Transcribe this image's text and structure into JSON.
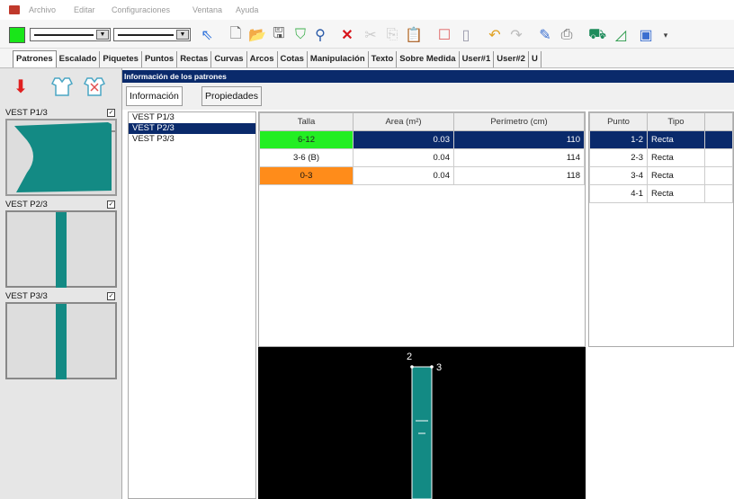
{
  "menu": {
    "items": [
      "Archivo",
      "Editar",
      "Configuraciones",
      "Ventana",
      "Ayuda"
    ]
  },
  "toolbar": {
    "color_swatch": "#19e619",
    "icons": [
      "pointer-icon",
      "new-icon",
      "open-icon",
      "save-icon",
      "garment-icon",
      "find-icon",
      "delete-icon",
      "cut-icon",
      "copy-icon",
      "paste-icon",
      "frame-icon",
      "page-icon",
      "undo-icon",
      "redo-icon",
      "edit-icon",
      "print-icon",
      "pattern-icon",
      "ruler-icon",
      "export-icon"
    ]
  },
  "tabs": [
    "Patrones",
    "Escalado",
    "Piquetes",
    "Puntos",
    "Rectas",
    "Curvas",
    "Arcos",
    "Cotas",
    "Manipulación",
    "Texto",
    "Sobre Medida",
    "User#1",
    "User#2",
    "U"
  ],
  "leftbar": {
    "patterns": [
      {
        "name": "VEST P1/3",
        "checked": "✓"
      },
      {
        "name": "VEST P2/3",
        "checked": "✓"
      },
      {
        "name": "VEST P3/3",
        "checked": "✓"
      }
    ]
  },
  "info_title": "Información de los patrones",
  "subtabs": [
    "Información",
    "Propiedades"
  ],
  "pattern_list": [
    "VEST P1/3",
    "VEST P2/3",
    "VEST P3/3"
  ],
  "size_table": {
    "headers": [
      "Talla",
      "Area (m²)",
      "Perímetro (cm)"
    ],
    "rows": [
      {
        "talla": "6-12",
        "area": "0.03",
        "perimetro": "110",
        "color": "#22ee22"
      },
      {
        "talla": "3-6 (B)",
        "area": "0.04",
        "perimetro": "114",
        "color": "#ffffff"
      },
      {
        "talla": "0-3",
        "area": "0.04",
        "perimetro": "118",
        "color": "#ff8c1a"
      }
    ]
  },
  "point_table": {
    "headers": [
      "Punto",
      "Tipo"
    ],
    "rows": [
      {
        "punto": "1-2",
        "tipo": "Recta"
      },
      {
        "punto": "2-3",
        "tipo": "Recta"
      },
      {
        "punto": "3-4",
        "tipo": "Recta"
      },
      {
        "punto": "4-1",
        "tipo": "Recta"
      }
    ]
  },
  "preview": {
    "label_top_left": "2",
    "label_top_right": "3",
    "pattern_color": "#138a84"
  }
}
